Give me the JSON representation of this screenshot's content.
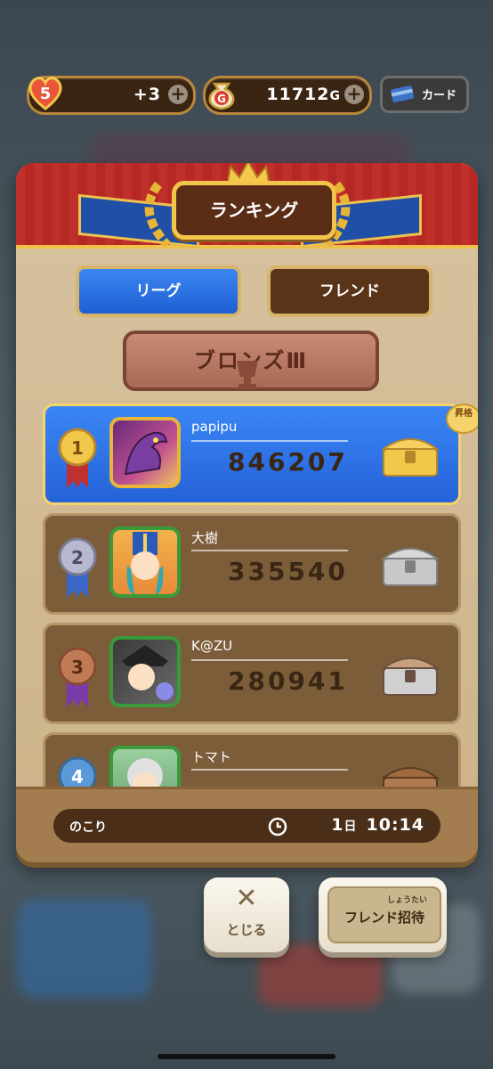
{
  "hud": {
    "hearts": "5",
    "hearts_bonus": "+3",
    "gold": "11712",
    "gold_unit": "G",
    "gold_icon_letter": "G",
    "card_label": "カード",
    "plus": "+"
  },
  "panel": {
    "title": "ランキング",
    "tabs": [
      {
        "label": "リーグ",
        "active": true
      },
      {
        "label": "フレンド",
        "active": false
      }
    ],
    "rank_name": "ブロンズⅢ",
    "promotion_badge": "昇格"
  },
  "leaderboard": [
    {
      "rank": "1",
      "name": "papipu",
      "score": "846207",
      "chest": "gold"
    },
    {
      "rank": "2",
      "name": "大樹",
      "score": "335540",
      "chest": "silver"
    },
    {
      "rank": "3",
      "name": "K@ZU",
      "score": "280941",
      "chest": "silver"
    },
    {
      "rank": "4",
      "name": "トマト",
      "score": "",
      "chest": "bronze"
    }
  ],
  "footer": {
    "remaining_label": "のこり",
    "remaining_days": "1",
    "days_unit": "日",
    "remaining_time": "10:14"
  },
  "buttons": {
    "close_icon": "✕",
    "close_label": "とじる",
    "invite_ruby": "しょうたい",
    "invite_label": "フレンド招待"
  },
  "colors": {
    "accent_blue": "#2562d8",
    "header_red": "#c0302a",
    "gold": "#f0c24c",
    "row_brown": "#7c5d3a"
  }
}
